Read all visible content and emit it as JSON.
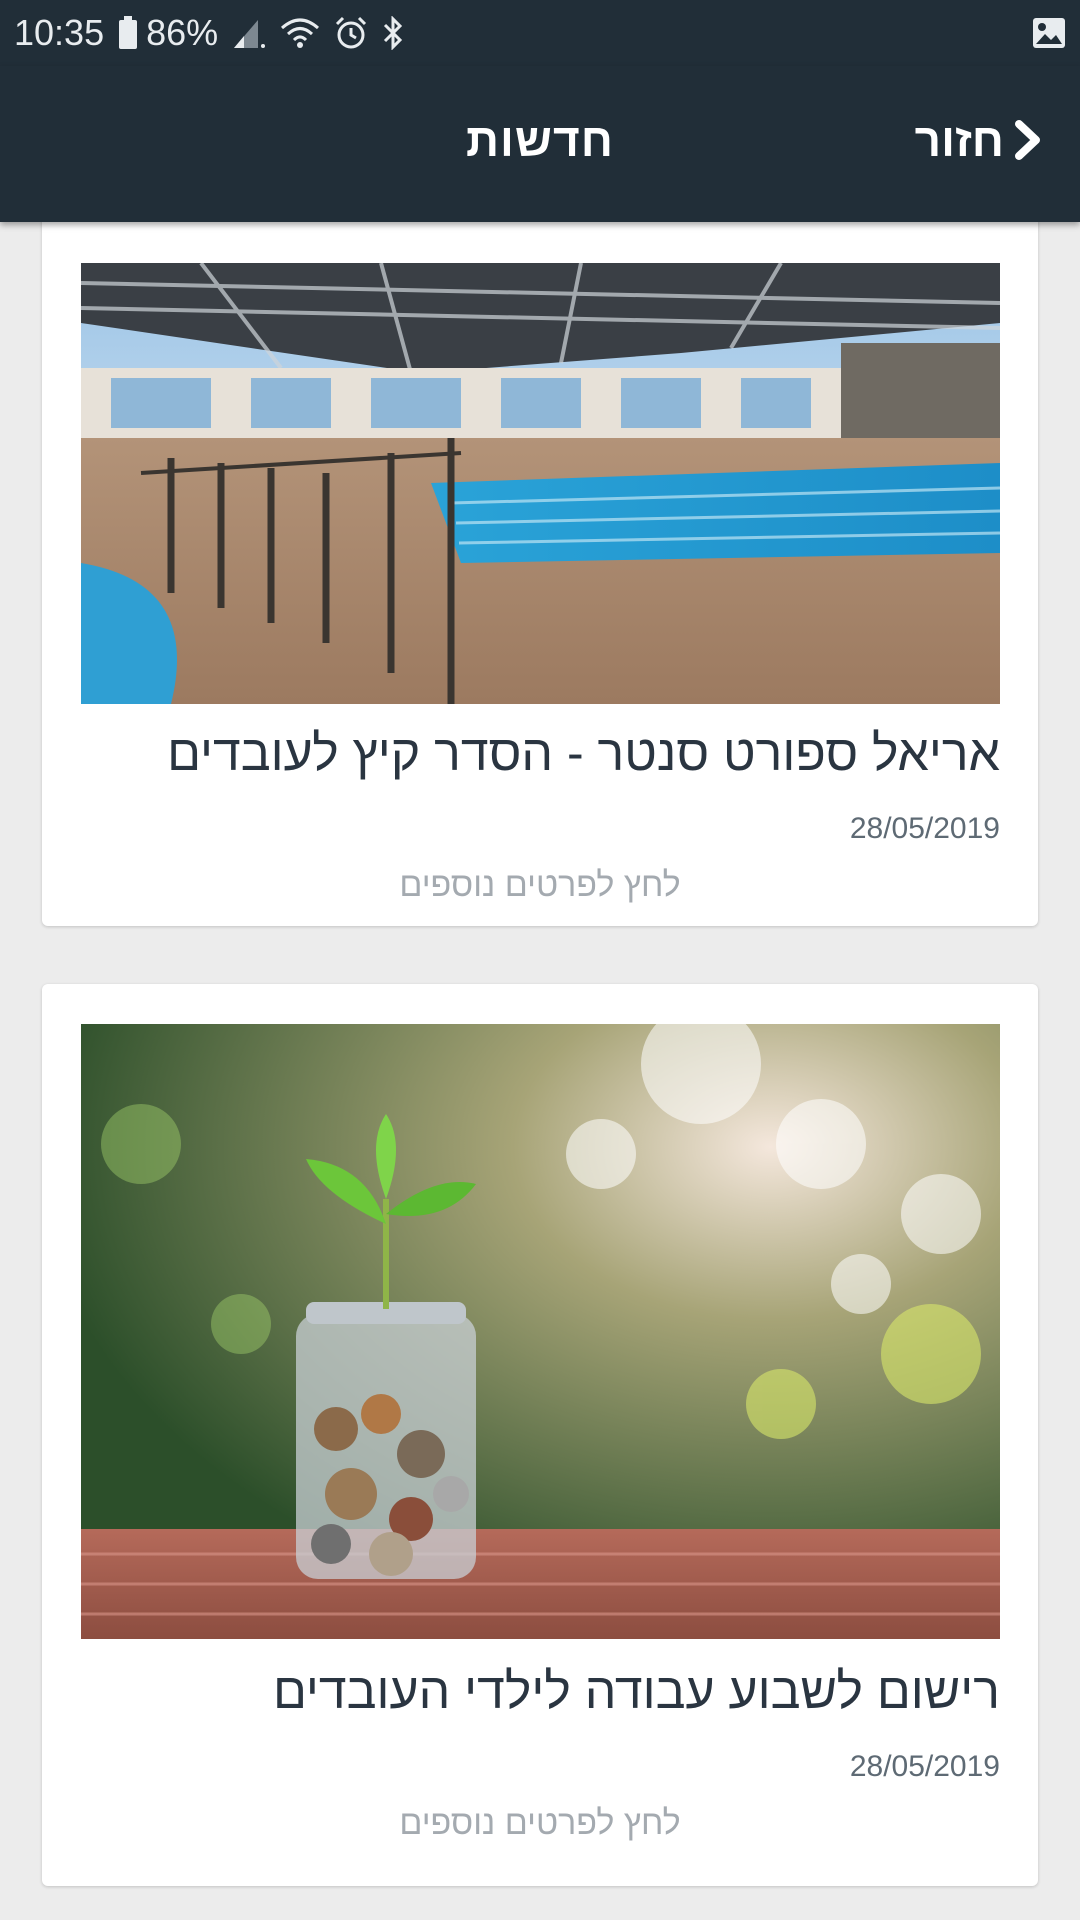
{
  "status_bar": {
    "time": "10:35",
    "battery_percent": "86%",
    "icons": [
      "battery-icon",
      "signal-icon",
      "wifi-icon",
      "alarm-icon",
      "bluetooth-icon",
      "image-notification-icon"
    ]
  },
  "app_bar": {
    "title": "חדשות",
    "back_label": "חזור",
    "back_icon": "chevron-right-icon",
    "background_color": "#212e38"
  },
  "articles": [
    {
      "image": "indoor-pool-photo",
      "title": "אריאל ספורט סנטר - הסדר קיץ לעובדים",
      "date": "28/05/2019",
      "more_label": "לחץ לפרטים נוספים"
    },
    {
      "image": "plant-coin-jar-photo",
      "title": "רישום לשבוע עבודה לילדי העובדים",
      "date": "28/05/2019",
      "more_label": "לחץ לפרטים נוספים"
    }
  ],
  "colors": {
    "page_background": "#ececec",
    "card_background": "#ffffff",
    "title_text": "#2a3541",
    "date_text": "#5e6a74",
    "more_text": "#a4aab0"
  }
}
